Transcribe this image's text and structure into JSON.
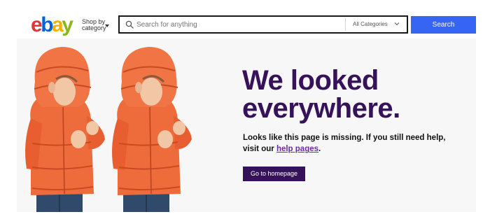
{
  "header": {
    "logo": {
      "letters": [
        "e",
        "b",
        "a",
        "y"
      ],
      "colors": [
        "#e53238",
        "#0064d2",
        "#f5af02",
        "#86b817"
      ]
    },
    "shop_by_category": {
      "line1": "Shop by",
      "line2": "category"
    },
    "search": {
      "placeholder": "Search for anything",
      "value": ""
    },
    "category_select": {
      "selected": "All Categories"
    },
    "search_button": "Search"
  },
  "hero": {
    "headline_line1": "We looked",
    "headline_line2": "everywhere.",
    "message_text": "Looks like this page is missing. If you still need help, visit our ",
    "help_link": "help pages",
    "message_end": ".",
    "home_button": "Go to homepage",
    "colors": {
      "headline": "#35125a",
      "button": "#35125a",
      "link": "#6f2a9f",
      "search_button": "#3665f3"
    }
  }
}
